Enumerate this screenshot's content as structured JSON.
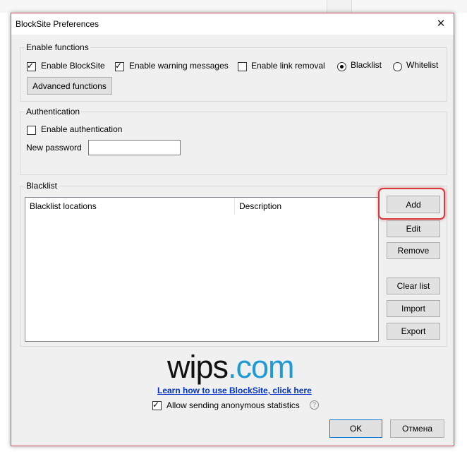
{
  "window": {
    "title": "BlockSite Preferences",
    "close_glyph": "✕"
  },
  "enable_functions": {
    "legend": "Enable functions",
    "enable_blocksite": {
      "label": "Enable BlockSite",
      "checked": true
    },
    "enable_warning": {
      "label": "Enable warning messages",
      "checked": true
    },
    "enable_link_removal": {
      "label": "Enable link removal",
      "checked": false
    },
    "blacklist_radio": {
      "label": "Blacklist",
      "selected": true
    },
    "whitelist_radio": {
      "label": "Whitelist",
      "selected": false
    },
    "advanced_button": "Advanced functions"
  },
  "authentication": {
    "legend": "Authentication",
    "enable_auth": {
      "label": "Enable authentication",
      "checked": false
    },
    "new_password_label": "New password",
    "new_password_value": ""
  },
  "blacklist": {
    "legend": "Blacklist",
    "columns": [
      "Blacklist locations",
      "Description"
    ],
    "rows": [],
    "buttons": {
      "add": "Add",
      "edit": "Edit",
      "remove": "Remove",
      "clear": "Clear list",
      "import": "Import",
      "export": "Export"
    }
  },
  "logo": {
    "part1": "wips",
    "part2": ".com",
    "color1": "#111111",
    "color2": "#1e9ad6"
  },
  "footer": {
    "learn_link": "Learn how to use BlockSite, click here",
    "allow_stats": {
      "label": "Allow sending anonymous statistics",
      "checked": true
    },
    "help_glyph": "?",
    "ok": "OK",
    "cancel": "Отмена"
  },
  "colors": {
    "highlight": "#d9363e",
    "link": "#0033cc",
    "window_border": "#d44d6a"
  }
}
